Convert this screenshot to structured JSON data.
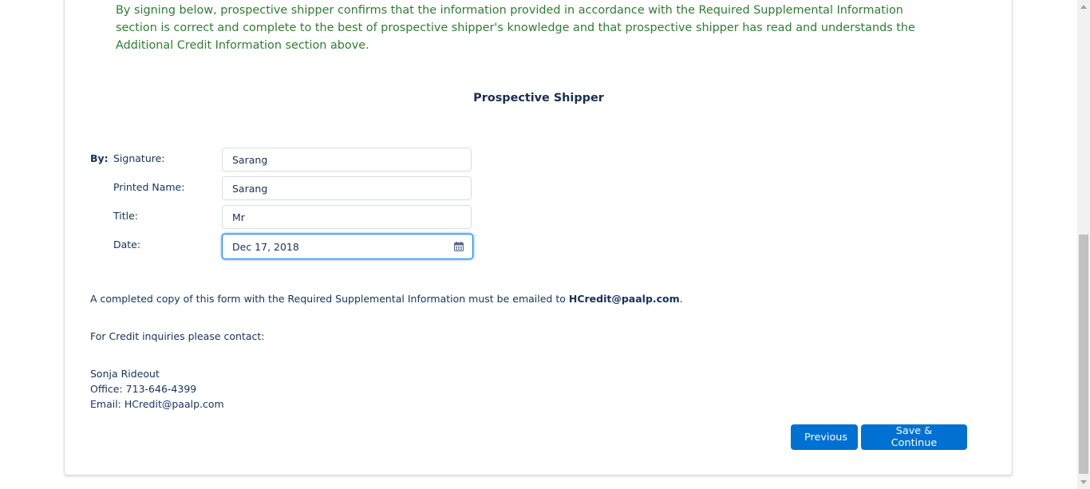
{
  "form": {
    "certification_text": "By signing below, prospective shipper confirms that the information provided in accordance with the Required Supplemental Information section is correct and complete to the best of prospective shipper's knowledge and that prospective shipper has read and understands the Additional Credit Information section above.",
    "section_title": "Prospective Shipper",
    "by_label": "By:",
    "fields": {
      "signature": {
        "label": "Signature:",
        "value": "Sarang"
      },
      "printed_name": {
        "label": "Printed Name:",
        "value": "Sarang"
      },
      "title": {
        "label": "Title:",
        "value": "Mr"
      },
      "date": {
        "label": "Date:",
        "value": "Dec 17, 2018",
        "icon": "calendar-icon"
      }
    }
  },
  "notes": {
    "copy_prefix": "A completed copy of this form with the Required Supplemental Information must be emailed to ",
    "copy_email": "HCredit@paalp.com",
    "copy_suffix": ".",
    "inquiries": "For Credit inquiries please contact:"
  },
  "contact": {
    "name": "Sonja Rideout",
    "office": "Office: 713-646-4399",
    "email": "Email: HCredit@paalp.com"
  },
  "buttons": {
    "previous": "Previous",
    "save_continue": "Save & Continue"
  },
  "colors": {
    "accent": "#0070d2",
    "certification_text": "#2e7d32",
    "label_text": "#16325c"
  }
}
